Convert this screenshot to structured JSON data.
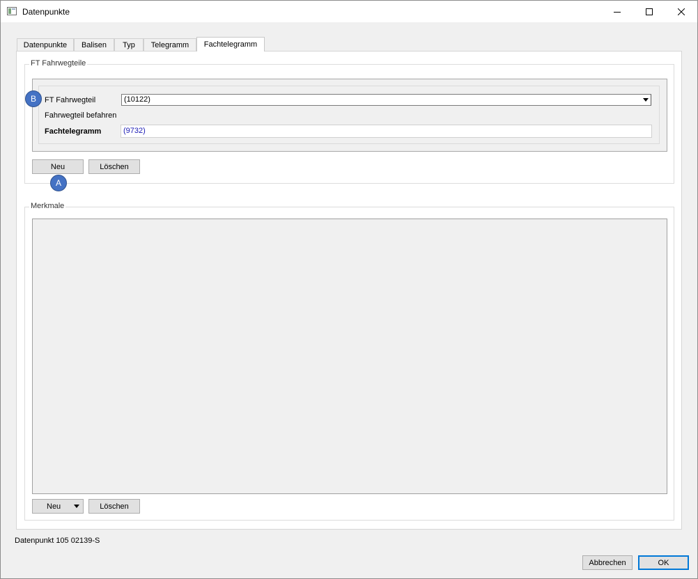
{
  "window": {
    "title": "Datenpunkte"
  },
  "tabs": [
    {
      "label": "Datenpunkte"
    },
    {
      "label": "Balisen"
    },
    {
      "label": "Typ"
    },
    {
      "label": "Telegramm"
    },
    {
      "label": "Fachtelegramm"
    }
  ],
  "active_tab": "Fachtelegramm",
  "ft_group": {
    "title": "FT Fahrwegteile",
    "fahrwegteil_label": "FT Fahrwegteil",
    "fahrwegteil_value": "(10122)",
    "befahren_label": "Fahrwegteil befahren",
    "fachtelegramm_label": "Fachtelegramm",
    "fachtelegramm_value": "(9732)",
    "new_label": "Neu",
    "delete_label": "Löschen"
  },
  "merkmale_group": {
    "title": "Merkmale",
    "new_label": "Neu",
    "delete_label": "Löschen"
  },
  "markers": {
    "a": "A",
    "b": "B"
  },
  "status": {
    "text": "Datenpunkt 105 02139-S"
  },
  "footer": {
    "cancel_label": "Abbrechen",
    "ok_label": "OK"
  },
  "colors": {
    "marker": "#4472c4",
    "link_value": "#1a1ab4",
    "default_button_border": "#0078d7"
  }
}
